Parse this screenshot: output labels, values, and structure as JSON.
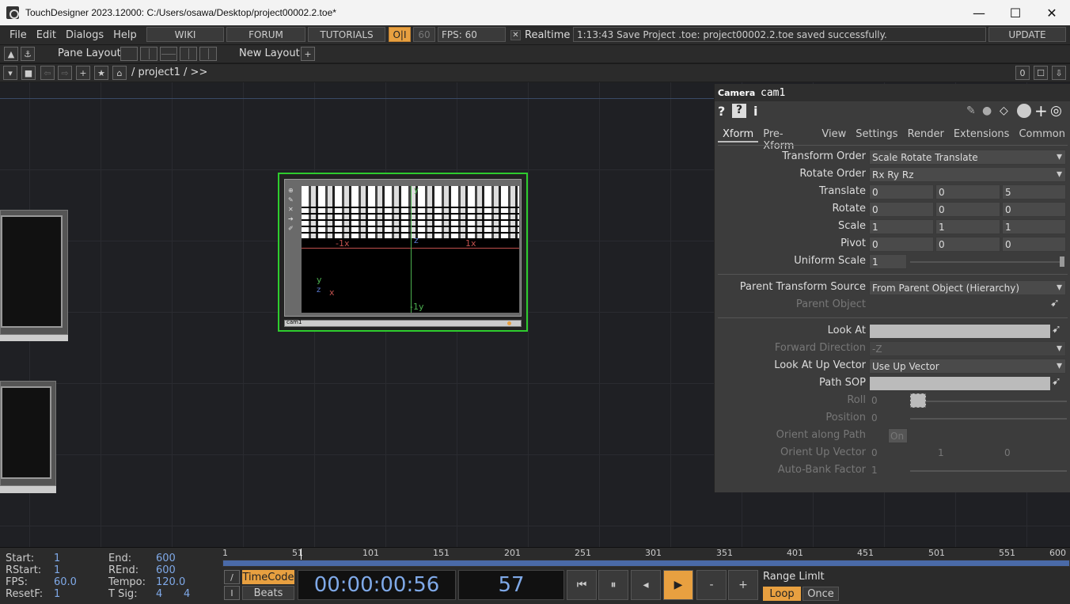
{
  "window": {
    "title": "TouchDesigner 2023.12000: C:/Users/osawa/Desktop/project00002.2.toe*",
    "minimize": "—",
    "maximize": "☐",
    "close": "✕"
  },
  "menu": [
    "File",
    "Edit",
    "Dialogs",
    "Help"
  ],
  "topbar": {
    "wiki": "WIKI",
    "forum": "FORUM",
    "tutorials": "TUTORIALS",
    "oi": "O|I",
    "fps_cap": "60",
    "fps_label": "FPS:  60",
    "realtime_check": "✕",
    "realtime": "Realtime",
    "status": "1:13:43 Save Project .toe: project00002.2.toe saved successfully.",
    "update": "UPDATE"
  },
  "toolbar2": {
    "pane_layout": "Pane Layout",
    "new_layout": "New Layout",
    "plus": "+"
  },
  "toolbar3": {
    "path": "/ project1 / >>",
    "counter": "0"
  },
  "node": {
    "name": "cam1",
    "axis_neg_x": "-1x",
    "axis_pos_x": "1x",
    "axis_z": "z",
    "axis_neg_y": "-1y",
    "axis_y": "y",
    "gizmo_x": "x",
    "gizmo_y": "y",
    "gizmo_z": "z"
  },
  "panel": {
    "type": "Camera",
    "name": "cam1",
    "tabs": [
      "Xform",
      "Pre-Xform",
      "View",
      "Settings",
      "Render",
      "Extensions",
      "Common"
    ],
    "params": {
      "transform_order": {
        "label": "Transform Order",
        "value": "Scale Rotate Translate"
      },
      "rotate_order": {
        "label": "Rotate Order",
        "value": "Rx Ry Rz"
      },
      "translate": {
        "label": "Translate",
        "v": [
          "0",
          "0",
          "5"
        ]
      },
      "rotate": {
        "label": "Rotate",
        "v": [
          "0",
          "0",
          "0"
        ]
      },
      "scale": {
        "label": "Scale",
        "v": [
          "1",
          "1",
          "1"
        ]
      },
      "pivot": {
        "label": "Pivot",
        "v": [
          "0",
          "0",
          "0"
        ]
      },
      "uniform_scale": {
        "label": "Uniform Scale",
        "value": "1"
      },
      "parent_transform_source": {
        "label": "Parent Transform Source",
        "value": "From Parent Object (Hierarchy)"
      },
      "parent_object": {
        "label": "Parent Object"
      },
      "look_at": {
        "label": "Look At"
      },
      "forward_direction": {
        "label": "Forward Direction",
        "value": "-Z"
      },
      "look_at_up_vector": {
        "label": "Look At Up Vector",
        "value": "Use Up Vector"
      },
      "path_sop": {
        "label": "Path SOP"
      },
      "roll": {
        "label": "Roll",
        "value": "0"
      },
      "position": {
        "label": "Position",
        "value": "0"
      },
      "orient_along_path": {
        "label": "Orient along Path",
        "value": "On"
      },
      "orient_up_vector": {
        "label": "Orient Up Vector",
        "v": [
          "0",
          "1",
          "0"
        ]
      },
      "auto_bank_factor": {
        "label": "Auto-Bank Factor",
        "value": "1"
      }
    }
  },
  "timeline": {
    "start_label": "Start:",
    "start": "1",
    "end_label": "End:",
    "end": "600",
    "rstart_label": "RStart:",
    "rstart": "1",
    "rend_label": "REnd:",
    "rend": "600",
    "fps_label": "FPS:",
    "fps": "60.0",
    "tempo_label": "Tempo:",
    "tempo": "120.0",
    "resetf_label": "ResetF:",
    "resetf": "1",
    "tsig_label": "T Sig:",
    "tsig_a": "4",
    "tsig_b": "4",
    "ruler": [
      "1",
      "51",
      "101",
      "151",
      "201",
      "251",
      "301",
      "351",
      "401",
      "451",
      "501",
      "551",
      "600"
    ],
    "timecode_btn": "TimeCode",
    "beats_btn": "Beats",
    "timecode": "00:00:00:56",
    "frame": "57",
    "range_limit": "Range Limlt",
    "loop": "Loop",
    "once": "Once",
    "slash": "/",
    "bar": "I",
    "minus": "-",
    "plus": "+"
  },
  "colors": {
    "accent": "#e8a040",
    "timecode_text": "#7fa9e8",
    "node_border": "#2ecc2e"
  }
}
